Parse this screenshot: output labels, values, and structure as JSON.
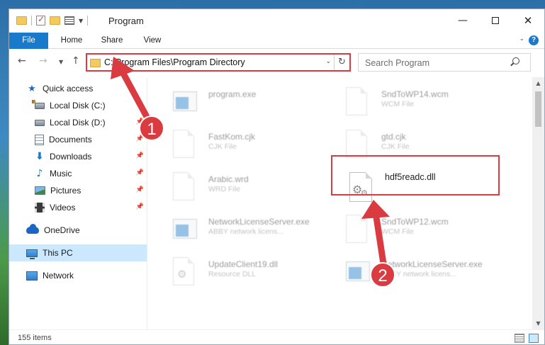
{
  "window": {
    "title": "Program",
    "minimize": "—",
    "close": "✕"
  },
  "ribbon": {
    "tabs": [
      "File",
      "Home",
      "Share",
      "View"
    ],
    "help": "?"
  },
  "nav": {
    "back": "←",
    "forward": "→",
    "recent": "▼",
    "up": "↑",
    "address": "C:\\Program Files\\Program Directory",
    "refresh": "↻",
    "search_placeholder": "Search Program"
  },
  "sidebar": {
    "items": [
      {
        "label": "Quick access",
        "icon": "star-icon",
        "pinned": false
      },
      {
        "label": "Local Disk (C:)",
        "icon": "disk-icon",
        "pinned": false
      },
      {
        "label": "Local Disk (D:)",
        "icon": "disk-icon",
        "pinned": true
      },
      {
        "label": "Documents",
        "icon": "documents-icon",
        "pinned": true
      },
      {
        "label": "Downloads",
        "icon": "download-icon",
        "pinned": true
      },
      {
        "label": "Music",
        "icon": "music-icon",
        "pinned": true
      },
      {
        "label": "Pictures",
        "icon": "pictures-icon",
        "pinned": true
      },
      {
        "label": "Videos",
        "icon": "videos-icon",
        "pinned": true
      },
      {
        "label": "OneDrive",
        "icon": "onedrive-icon",
        "pinned": false
      },
      {
        "label": "This PC",
        "icon": "this-pc-icon",
        "pinned": false,
        "selected": true
      },
      {
        "label": "Network",
        "icon": "network-icon",
        "pinned": false
      }
    ],
    "pin_glyph": "📌"
  },
  "files": [
    {
      "name": "program.exe",
      "type": "",
      "icon": "exe-icon",
      "faded": true
    },
    {
      "name": "SndToWP14.wcm",
      "type": "WCM File",
      "icon": "doc-icon",
      "faded": true
    },
    {
      "name": "FastKom.cjk",
      "type": "CJK File",
      "icon": "doc-icon",
      "faded": true
    },
    {
      "name": "gtd.cjk",
      "type": "CJK File",
      "icon": "doc-icon",
      "faded": true
    },
    {
      "name": "Arabic.wrd",
      "type": "WRD File",
      "icon": "doc-icon",
      "faded": true
    },
    {
      "name": "hdf5readc.dll",
      "type": "",
      "icon": "dll-gear-icon",
      "faded": false,
      "highlighted": true
    },
    {
      "name": "NetworkLicenseServer.exe",
      "type": "ABBY network licens...",
      "icon": "exe-icon",
      "faded": true
    },
    {
      "name": "SndToWP12.wcm",
      "type": "WCM File",
      "icon": "doc-icon",
      "faded": true
    },
    {
      "name": "UpdateClient19.dll",
      "type": "Resource DLL",
      "icon": "dll-gear-icon",
      "faded": true
    },
    {
      "name": "NetworkLicenseServer.exe",
      "type": "ABBY network licens...",
      "icon": "exe-icon",
      "faded": true
    }
  ],
  "status": {
    "item_count": "155 items"
  },
  "annotations": {
    "step1": "1",
    "step2": "2",
    "accent": "#d93b41"
  },
  "colors": {
    "file_tab": "#1979ca",
    "selected_nav": "#cce8ff",
    "annotation_red": "#d93b41"
  }
}
